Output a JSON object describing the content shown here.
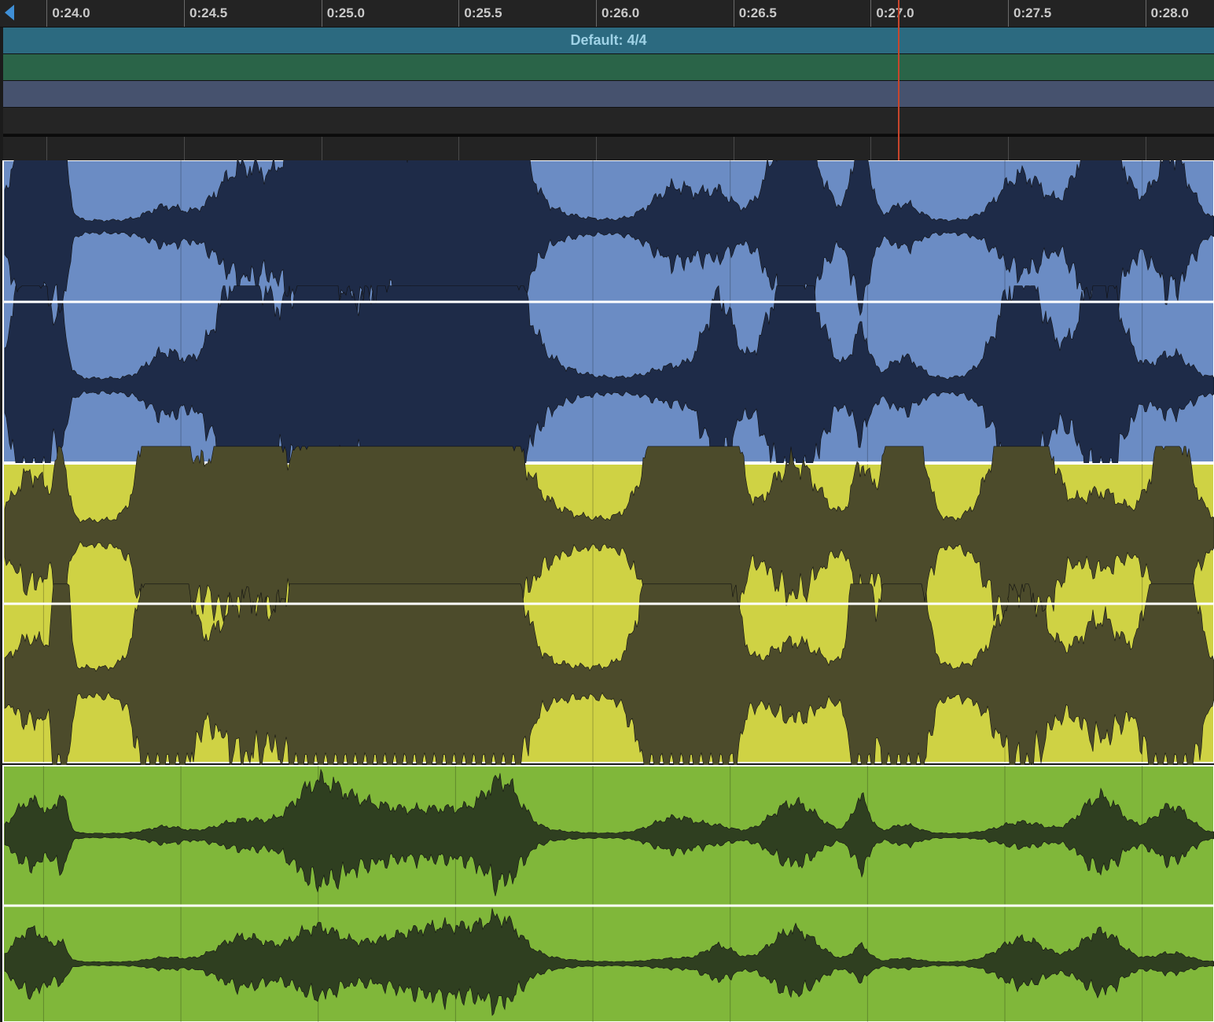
{
  "timeline": {
    "ticks": [
      "0:24.0",
      "0:24.5",
      "0:25.0",
      "0:25.5",
      "0:26.0",
      "0:26.5",
      "0:27.0",
      "0:27.5",
      "0:28.0"
    ],
    "range_seconds": [
      23.83,
      28.25
    ],
    "playhead_time": "0:27.1"
  },
  "lanes": {
    "signature_label": "Default: 4/4"
  },
  "tracks": [
    {
      "name": "track-blue",
      "region_color": "#6b8cc4",
      "wave_color": "#1e2b48",
      "channels": 2,
      "mode": "normal"
    },
    {
      "name": "track-yellow",
      "region_color": "#cfd244",
      "wave_color": "#4c4b2b",
      "channels": 2,
      "mode": "saturated"
    },
    {
      "name": "track-green",
      "region_color": "#80b73a",
      "wave_color": "#2f3f20",
      "channels": 2,
      "mode": "quiet"
    }
  ],
  "colors": {
    "playhead": "#c8452c",
    "ruler_bg": "#232323",
    "ruler_text": "#c9c9c9",
    "scroll_arrow": "#3f8fd6",
    "signature_lane": "#2c6a80",
    "marker_lane": "#2a6448",
    "tempo_lane": "#46526e"
  },
  "icons": {
    "scroll_left": "triangle-left-icon"
  }
}
